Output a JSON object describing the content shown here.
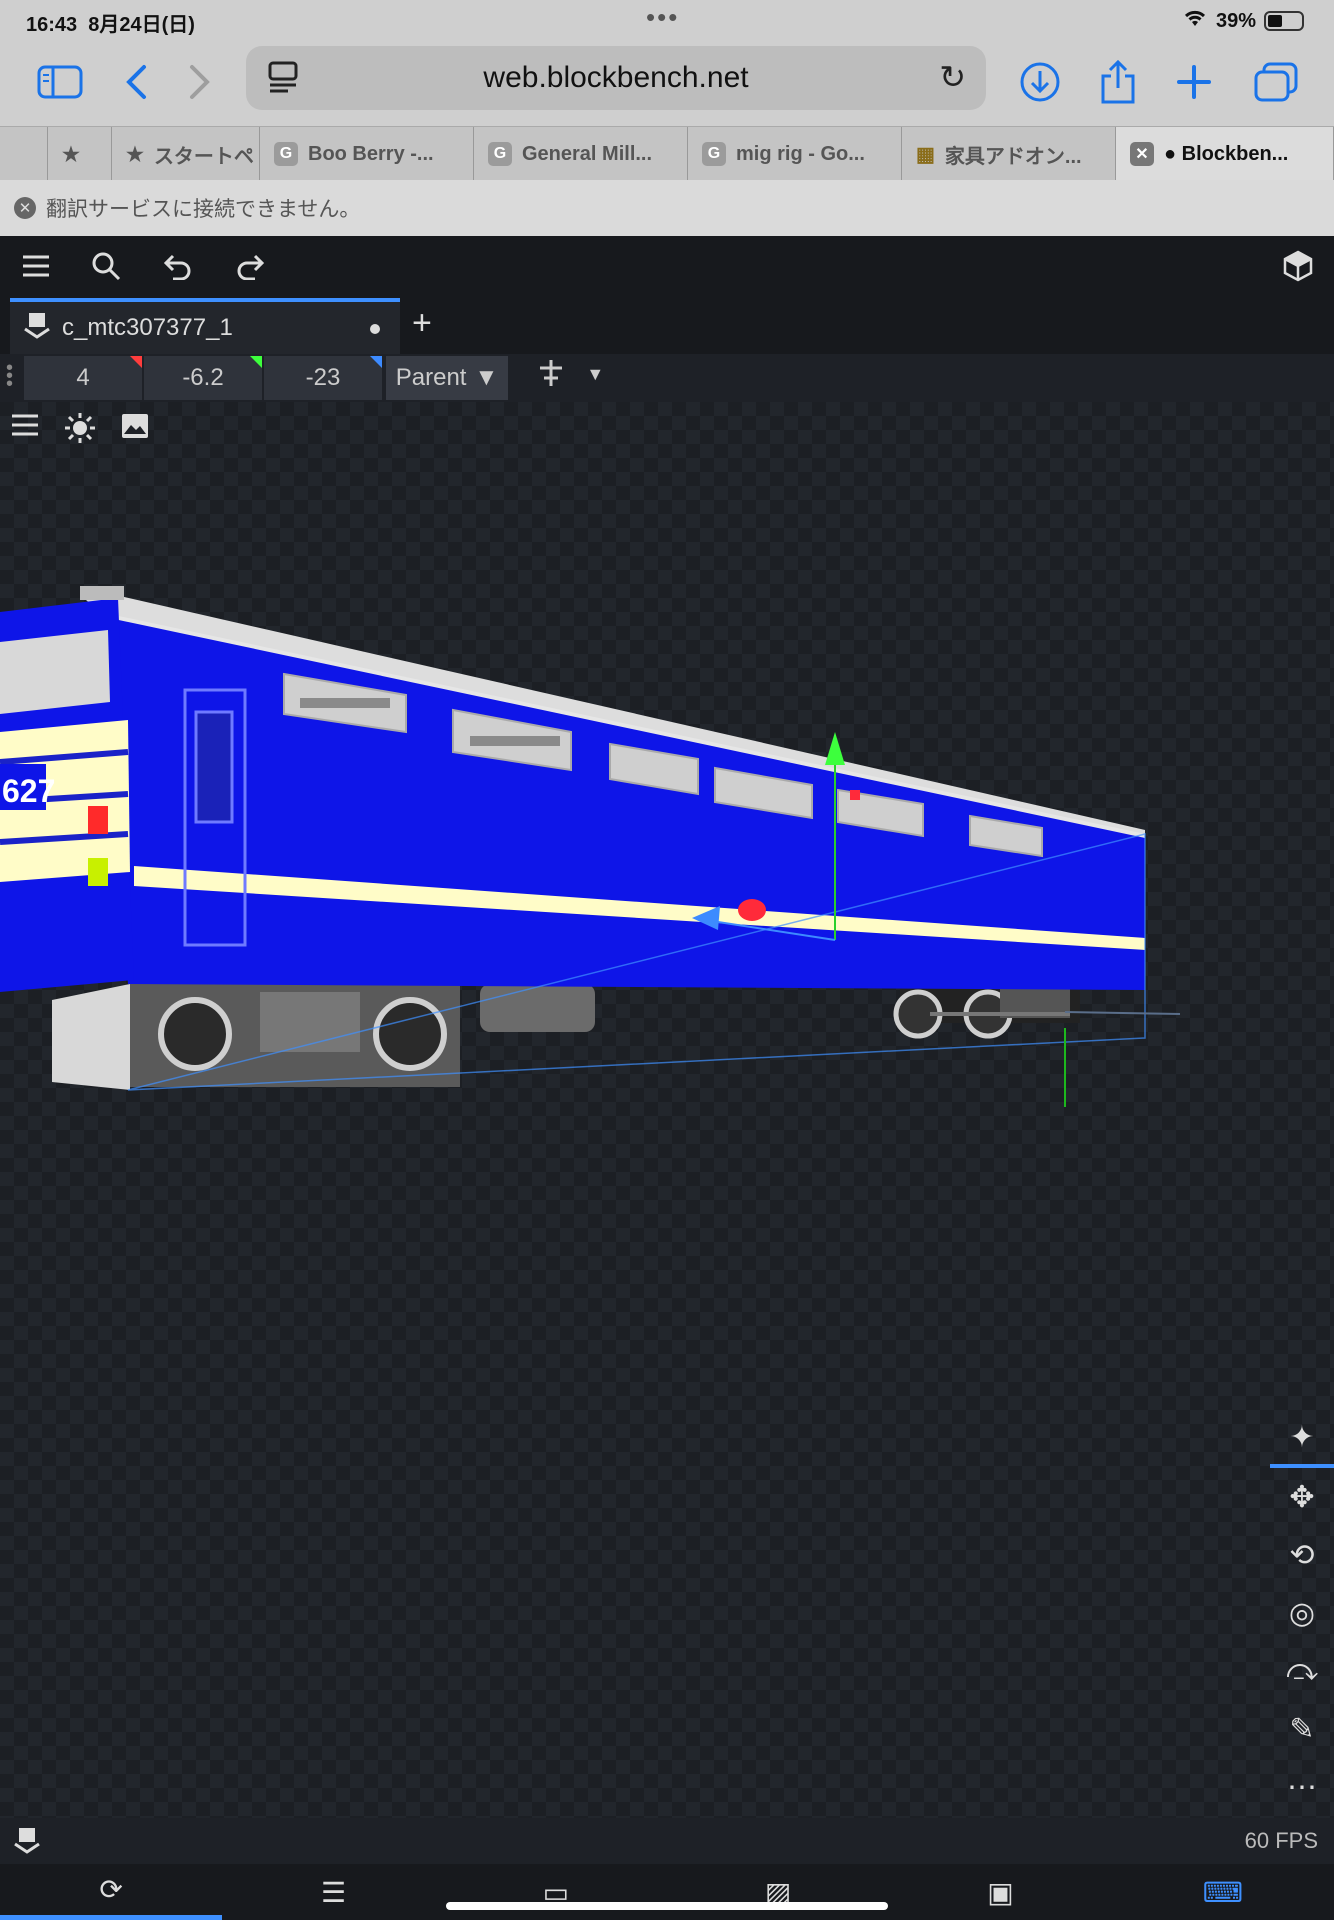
{
  "status": {
    "time": "16:43",
    "date": "8月24日(日)",
    "battery": "39%",
    "dots": "•••"
  },
  "browser": {
    "url": "web.blockbench.net",
    "icons": [
      "sidebar-icon",
      "back-icon",
      "forward-icon",
      "reader-icon",
      "reload-icon",
      "download-icon",
      "share-icon",
      "new-tab-icon",
      "tabs-icon"
    ],
    "tabs": [
      {
        "label": ""
      },
      {
        "label": ""
      },
      {
        "label": "スタートペ"
      },
      {
        "label": "Boo Berry -..."
      },
      {
        "label": "General Mill..."
      },
      {
        "label": "mig rig - Go..."
      },
      {
        "label": "家具アドオン..."
      },
      {
        "label": "● Blockben..."
      }
    ],
    "translate_msg": "翻訳サービスに接続できません。"
  },
  "app": {
    "file_name": "c_mtc307377_1",
    "coords": {
      "x": "4",
      "y": "-6.2",
      "z": "-23"
    },
    "space": "Parent",
    "fps": "60 FPS",
    "colors": {
      "accent": "#3e90ff",
      "x": "#ff3d3d",
      "y": "#3dff3d",
      "z": "#3d8bff",
      "train_blue": "#0e15e8",
      "stripe": "#fffcc8"
    },
    "model_number": "627"
  }
}
